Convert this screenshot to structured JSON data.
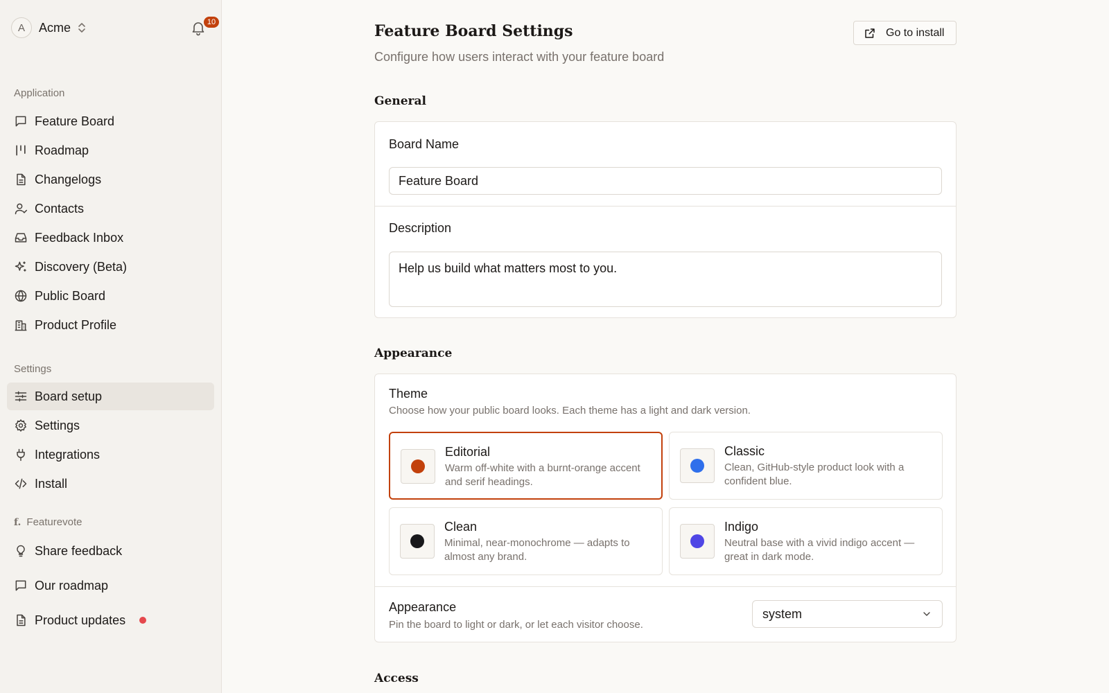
{
  "workspace": {
    "avatar_letter": "A",
    "name": "Acme",
    "notification_count": "10"
  },
  "sidebar": {
    "application_label": "Application",
    "application_items": [
      {
        "label": "Feature Board",
        "icon": "message-square-icon"
      },
      {
        "label": "Roadmap",
        "icon": "kanban-icon"
      },
      {
        "label": "Changelogs",
        "icon": "file-text-icon"
      },
      {
        "label": "Contacts",
        "icon": "user-icon"
      },
      {
        "label": "Feedback Inbox",
        "icon": "inbox-icon"
      },
      {
        "label": "Discovery (Beta)",
        "icon": "sparkles-icon"
      },
      {
        "label": "Public Board",
        "icon": "globe-icon"
      },
      {
        "label": "Product Profile",
        "icon": "building-icon"
      }
    ],
    "settings_label": "Settings",
    "settings_items": [
      {
        "label": "Board setup",
        "icon": "sliders-icon",
        "active": true
      },
      {
        "label": "Settings",
        "icon": "gear-icon"
      },
      {
        "label": "Integrations",
        "icon": "plug-icon"
      },
      {
        "label": "Install",
        "icon": "code-icon"
      }
    ],
    "featurevote_label": "Featurevote",
    "featurevote_logo": "f.",
    "featurevote_items": [
      {
        "label": "Share feedback",
        "icon": "lightbulb-icon"
      },
      {
        "label": "Our roadmap",
        "icon": "message-square-icon"
      },
      {
        "label": "Product updates",
        "icon": "file-text-icon",
        "unread_dot": true
      }
    ]
  },
  "page": {
    "title": "Feature Board Settings",
    "subtitle": "Configure how users interact with your feature board",
    "install_button": "Go to install"
  },
  "general": {
    "heading": "General",
    "board_name_label": "Board Name",
    "board_name_value": "Feature Board",
    "description_label": "Description",
    "description_value": "Help us build what matters most to you."
  },
  "appearance": {
    "heading": "Appearance",
    "theme_title": "Theme",
    "theme_desc": "Choose how your public board looks. Each theme has a light and dark version.",
    "themes": [
      {
        "name": "Editorial",
        "desc": "Warm off-white with a burnt-orange accent and serif headings.",
        "color": "#c2410c",
        "selected": true
      },
      {
        "name": "Classic",
        "desc": "Clean, GitHub-style product look with a confident blue.",
        "color": "#2f6feb",
        "selected": false
      },
      {
        "name": "Clean",
        "desc": "Minimal, near-monochrome — adapts to almost any brand.",
        "color": "#18181b",
        "selected": false
      },
      {
        "name": "Indigo",
        "desc": "Neutral base with a vivid indigo accent — great in dark mode.",
        "color": "#4f46e5",
        "selected": false
      }
    ],
    "mode_title": "Appearance",
    "mode_desc": "Pin the board to light or dark, or let each visitor choose.",
    "mode_value": "system"
  },
  "access": {
    "heading": "Access"
  },
  "colors": {
    "accent": "#c2410c",
    "notification_dot": "#e5484d"
  }
}
